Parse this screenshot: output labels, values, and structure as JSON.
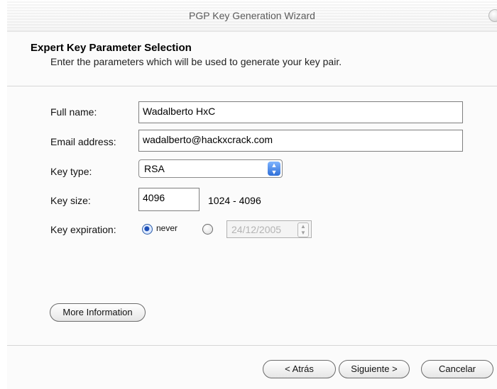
{
  "window": {
    "title": "PGP Key Generation Wizard"
  },
  "header": {
    "title": "Expert Key Parameter Selection",
    "subtitle": "Enter the parameters which will be used to generate your key pair."
  },
  "form": {
    "full_name_label": "Full name:",
    "full_name_value": "Wadalberto HxC",
    "email_label": "Email address:",
    "email_value": "wadalberto@hackxcrack.com",
    "key_type_label": "Key type:",
    "key_type_value": "RSA",
    "key_size_label": "Key size:",
    "key_size_value": "4096",
    "key_size_range": "1024 - 4096",
    "expiration_label": "Key expiration:",
    "expiration_never_label": "never",
    "expiration_selected": "never",
    "expiration_date": "24/12/2005"
  },
  "buttons": {
    "more_info": "More Information",
    "back": "< Atrás",
    "next": "Siguiente >",
    "cancel": "Cancelar"
  },
  "icons": {
    "select_arrow": "chevron-up-down-icon",
    "date_spinner": "spinner-icon",
    "close": "close-icon"
  },
  "colors": {
    "accent": "#2f6fd8",
    "disabled_text": "#b4b4b4"
  }
}
